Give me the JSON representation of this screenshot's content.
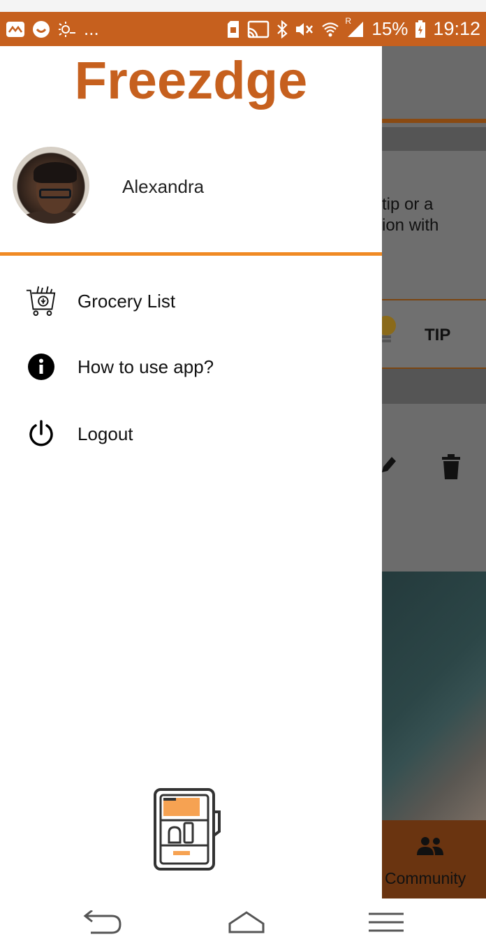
{
  "status_bar": {
    "overflow": "...",
    "battery_percent": "15%",
    "time": "19:12",
    "signal_label": "R",
    "icons_left": [
      "app-icon",
      "smiley-icon",
      "weather-icon"
    ],
    "icons_right": [
      "sim-icon",
      "cast-icon",
      "bluetooth-icon",
      "vibrate-icon",
      "wifi-icon",
      "signal-icon",
      "battery-icon"
    ]
  },
  "drawer": {
    "brand": "Freezdge",
    "user": {
      "name": "Alexandra"
    },
    "menu": [
      {
        "label": "Grocery List",
        "icon": "grocery-cart-icon"
      },
      {
        "label": "How to use app?",
        "icon": "info-icon"
      },
      {
        "label": "Logout",
        "icon": "power-icon"
      }
    ],
    "footer_icon": "fridge-icon"
  },
  "background": {
    "card_text": "tip or a\nion with",
    "tip_label": "TIP",
    "nav_label": "Community"
  },
  "colors": {
    "brand": "#c6601e",
    "accent_line": "#f08a24",
    "status_bar": "#c6601e"
  }
}
